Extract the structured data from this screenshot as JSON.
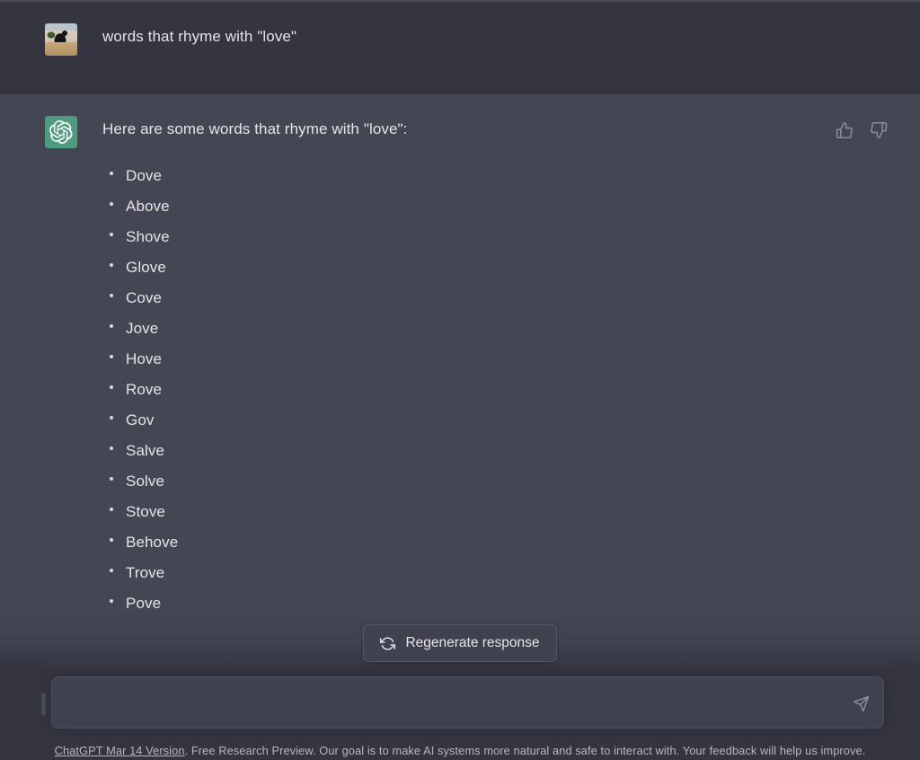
{
  "window": {
    "background_color": "#343541",
    "assistant_row_color": "#444654",
    "accent_green": "#4e9b80",
    "text_color": "#e4e4e7"
  },
  "conversation": {
    "user_message": {
      "avatar_name": "user-photo-avatar",
      "text": "words that rhyme with \"love\""
    },
    "assistant_message": {
      "avatar_name": "chatgpt-logo-avatar",
      "intro": "Here are some words that rhyme with \"love\":",
      "items": [
        "Dove",
        "Above",
        "Shove",
        "Glove",
        "Cove",
        "Jove",
        "Hove",
        "Rove",
        "Gov",
        "Salve",
        "Solve",
        "Stove",
        "Behove",
        "Trove",
        "Pove"
      ],
      "feedback": {
        "thumbs_up_label": "Good response",
        "thumbs_down_label": "Bad response"
      }
    }
  },
  "regenerate": {
    "label": "Regenerate response",
    "icon": "refresh-icon"
  },
  "composer": {
    "value": "",
    "placeholder": "",
    "send_icon": "send-paper-plane-icon"
  },
  "footer": {
    "link_text": "ChatGPT Mar 14 Version",
    "rest_text": ". Free Research Preview. Our goal is to make AI systems more natural and safe to interact with. Your feedback will help us improve."
  }
}
